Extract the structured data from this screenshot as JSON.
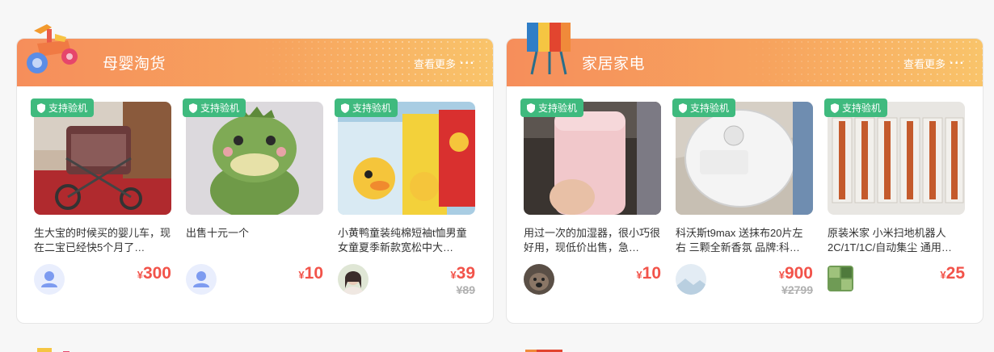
{
  "sections": [
    {
      "title": "母婴淘货",
      "see_more": "查看更多",
      "icon": "tricycle-toy-icon",
      "products": [
        {
          "badge": "支持验机",
          "desc": "生大宝的时候买的婴儿车，现在二宝已经快5个月了…",
          "yen": "¥",
          "price": "300",
          "orig": "",
          "avatar": "default-user-avatar",
          "image": "baby-stroller-photo"
        },
        {
          "badge": "支持验机",
          "desc": "出售十元一个",
          "yen": "¥",
          "price": "10",
          "orig": "",
          "avatar": "default-user-avatar",
          "image": "green-dinosaur-plush-photo"
        },
        {
          "badge": "支持验机",
          "desc": "小黄鸭童装纯棉短袖t恤男童女童夏季新款宽松中大…",
          "yen": "¥",
          "price": "39",
          "orig": "¥89",
          "avatar": "girl-photo-avatar",
          "image": "duck-kids-tshirts-photo"
        }
      ]
    },
    {
      "title": "家居家电",
      "see_more": "查看更多",
      "icon": "floor-lamp-icon",
      "products": [
        {
          "badge": "支持验机",
          "desc": "用过一次的加湿器，很小巧很好用，现低价出售，急…",
          "yen": "¥",
          "price": "10",
          "orig": "",
          "avatar": "dog-photo-avatar",
          "image": "pink-humidifier-photo"
        },
        {
          "badge": "支持验机",
          "desc": "科沃斯t9max 送抹布20片左右 三颗全新香氛 品牌:科…",
          "yen": "¥",
          "price": "900",
          "orig": "¥2799",
          "avatar": "landscape-photo-avatar",
          "image": "robot-vacuum-photo"
        },
        {
          "badge": "支持验机",
          "desc": "原装米家 小米扫地机器人2C/1T/1C/自动集尘 通用…",
          "yen": "¥",
          "price": "25",
          "orig": "",
          "avatar": "green-tile-avatar",
          "image": "vacuum-brushes-photo"
        }
      ]
    }
  ],
  "colors": {
    "header_start": "#f68e5b",
    "header_end": "#f9c46a",
    "badge": "#3fba7e",
    "price": "#f2534a",
    "orig_price": "#b0b0b0"
  }
}
